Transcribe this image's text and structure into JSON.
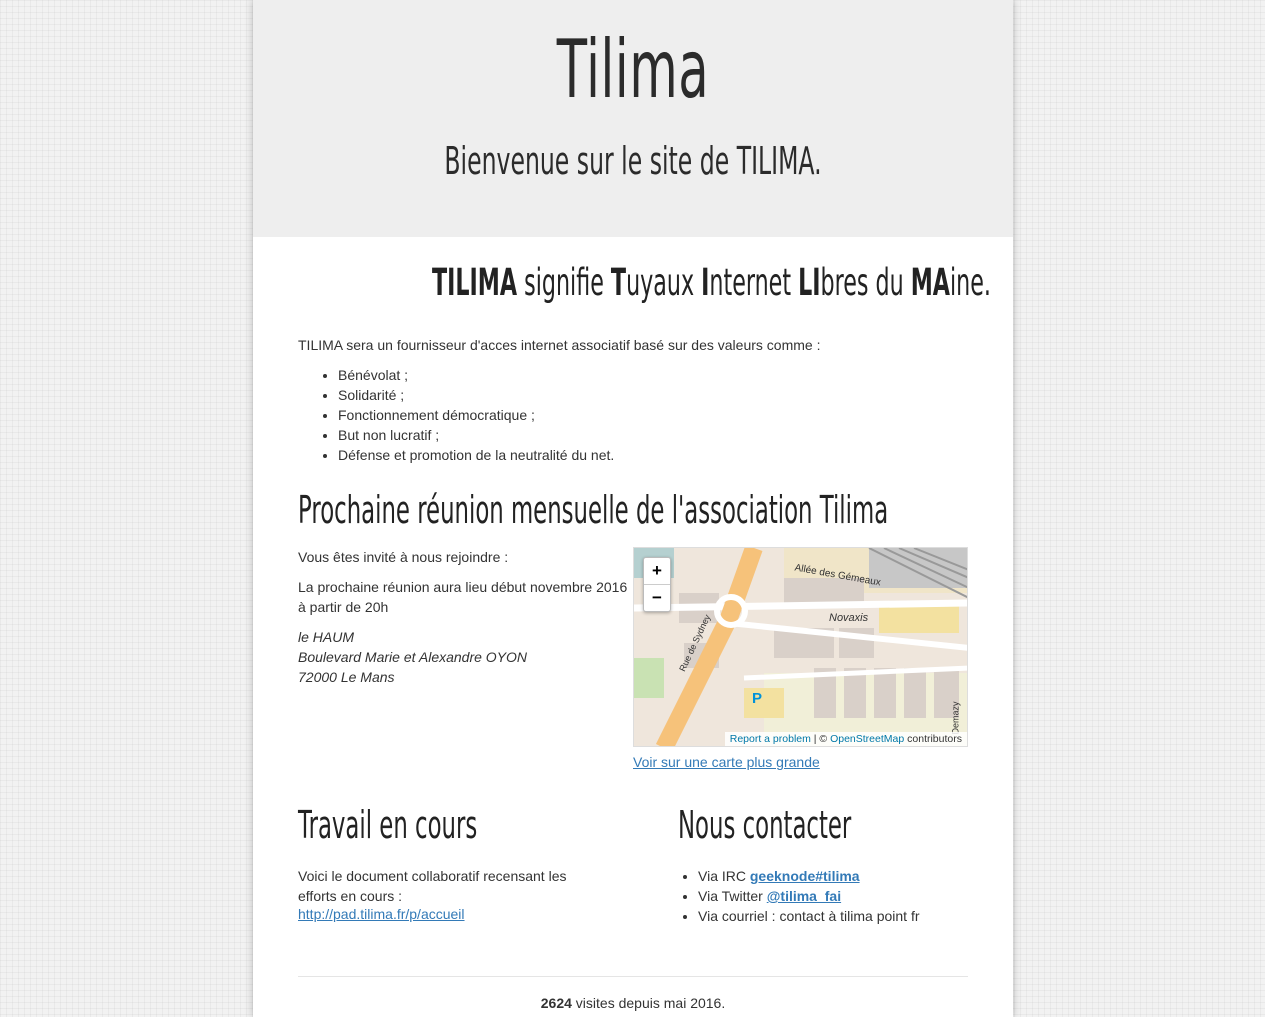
{
  "header": {
    "title": "Tilima",
    "subtitle": "Bienvenue sur le site de TILIMA."
  },
  "meaning": {
    "parts": [
      "TILIMA",
      " signifie ",
      "T",
      "uyaux ",
      "I",
      "nternet ",
      "LI",
      "bres du ",
      "MA",
      "ine."
    ]
  },
  "intro": {
    "text": "TILIMA sera un fournisseur d'acces internet associatif basé sur des valeurs comme :",
    "values": [
      "Bénévolat ;",
      "Solidarité ;",
      "Fonctionnement démocratique ;",
      "But non lucratif ;",
      "Défense et promotion de la neutralité du net."
    ]
  },
  "meeting": {
    "title": "Prochaine réunion mensuelle de l'association Tilima",
    "invite": "Vous êtes invité à nous rejoindre :",
    "next": "La prochaine réunion aura lieu début novembre 2016 à partir de 20h",
    "address_lines": [
      "le HAUM",
      "Boulevard Marie et Alexandre OYON",
      "72000 Le Mans"
    ],
    "map": {
      "zoom_in": "+",
      "zoom_out": "−",
      "labels": {
        "street1": "Allée des Gémeaux",
        "street2": "Novaxis",
        "street3": "Rue de Sydney",
        "street4": "Demazy",
        "parking": "P"
      },
      "report": "Report a problem",
      "separator": " | © ",
      "osm": "OpenStreetMap",
      "contributors": " contributors"
    },
    "bigger_map_link": "Voir sur une carte plus grande"
  },
  "work": {
    "title": "Travail en cours",
    "text": "Voici le document collaboratif recensant les efforts en cours :",
    "link": "http://pad.tilima.fr/p/accueil"
  },
  "contact": {
    "title": "Nous contacter",
    "irc_prefix": "Via IRC ",
    "irc_link": "geeknode#tilima",
    "twitter_prefix": "Via Twitter ",
    "twitter_link": "@tilima_fai",
    "mail": "Via courriel : contact à tilima point fr"
  },
  "footer": {
    "count": "2624",
    "text": " visites depuis mai 2016."
  },
  "colors": {
    "link": "#337ab7",
    "header_bg": "#eeeeee",
    "map_road": "#f6c27a"
  }
}
